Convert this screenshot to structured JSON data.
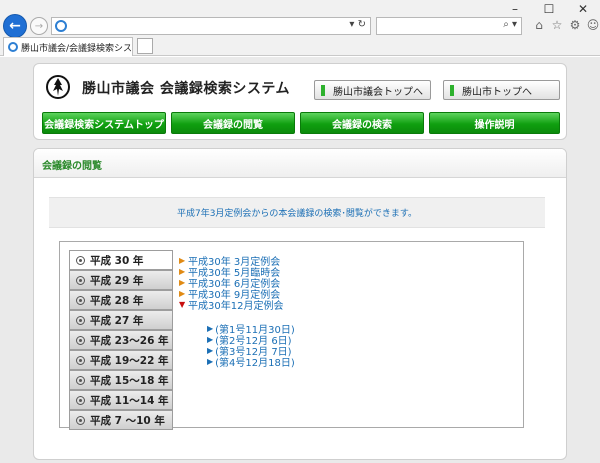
{
  "browser": {
    "window_controls": {
      "minimize": "–",
      "maximize": "☐",
      "close": "✕"
    },
    "back_glyph": "←",
    "forward_glyph": "→",
    "address_tools": "▾ ↻",
    "search_tools": "⌕ ▾",
    "toolbar_icons": [
      "⌂",
      "☆",
      "⚙",
      "☺"
    ],
    "tab_title": "勝山市議会/会議録検索シス...",
    "tab_close": "✕"
  },
  "header": {
    "site_title": "勝山市議会  会議録検索システム",
    "link_council_top": "勝山市議会トップへ",
    "link_city_top": "勝山市トップへ",
    "nav": [
      {
        "label": "会議録検索システムトップ"
      },
      {
        "label": "会議録の閲覧"
      },
      {
        "label": "会議録の検索"
      },
      {
        "label": "操作説明"
      }
    ]
  },
  "content": {
    "section_title": "会議録の閲覧",
    "notice": "平成7年3月定例会からの本会議録の検索･閲覧ができます。",
    "year_tabs": [
      {
        "label": "平成 30 年",
        "active": true
      },
      {
        "label": "平成 29 年",
        "active": false
      },
      {
        "label": "平成 28 年",
        "active": false
      },
      {
        "label": "平成 27 年",
        "active": false
      },
      {
        "label": "平成 23～26 年",
        "active": false
      },
      {
        "label": "平成 19～22 年",
        "active": false
      },
      {
        "label": "平成 15～18 年",
        "active": false
      },
      {
        "label": "平成 11～14 年",
        "active": false
      },
      {
        "label": "平成 7 ～10 年",
        "active": false
      }
    ],
    "sessions": [
      {
        "label": "平成30年 3月定例会",
        "expanded": false
      },
      {
        "label": "平成30年 5月臨時会",
        "expanded": false
      },
      {
        "label": "平成30年 6月定例会",
        "expanded": false
      },
      {
        "label": "平成30年 9月定例会",
        "expanded": false
      },
      {
        "label": "平成30年12月定例会",
        "expanded": true
      }
    ],
    "issues": [
      {
        "label": "(第1号11月30日)"
      },
      {
        "label": "(第2号12月 6日)"
      },
      {
        "label": "(第3号12月 7日)"
      },
      {
        "label": "(第4号12月18日)"
      }
    ],
    "markers": {
      "closed": "▶",
      "open": "▼",
      "issue": "▶"
    }
  }
}
